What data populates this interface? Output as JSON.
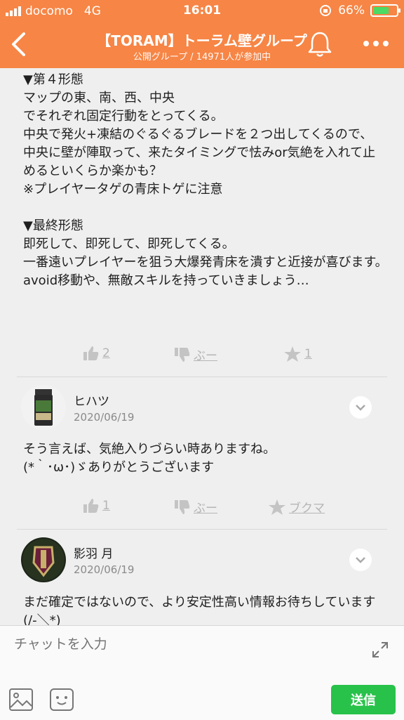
{
  "status_bar": {
    "carrier": "docomo",
    "network": "4G",
    "time": "16:01",
    "battery": "66%"
  },
  "header": {
    "title": "【TORAM】トーラム壁グループ",
    "subtitle": "公開グループ / 14971人が参加中"
  },
  "post": {
    "text": "▼第４形態\nマップの東、南、西、中央\nでそれぞれ固定行動をとってくる。\n中央で発火+凍結のぐるぐるブレードを２つ出してくるので、\n中央に壁が陣取って、来たタイミングで怯みor気絶を入れて止めるといくらか楽かも？\n※プレイヤータゲの青床トゲに注意\n\n▼最終形態\n即死して、即死して、即死してくる。\n一番遠いプレイヤーを狙う大爆発青床を潰すと近接が喜びます。\navoid移動や、無敵スキルを持っていきましょう…",
    "likes": "2",
    "boo": "ぶー",
    "stars": "1"
  },
  "comments": [
    {
      "name": "ヒハツ",
      "date": "2020/06/19",
      "text": "そう言えば、気絶入りづらい時ありますね。\n(*｀･ω･)ゞありがとうございます",
      "likes": "1",
      "boo": "ぶー",
      "bookmark": "ブクマ"
    },
    {
      "name": "影羽 月",
      "date": "2020/06/19",
      "text": "まだ確定ではないので、より安定性高い情報お待ちしています(/-＼*)"
    }
  ],
  "chat": {
    "placeholder": "チャットを入力",
    "send": "送信"
  },
  "colors": {
    "header": "#f78545",
    "send": "#28c24a",
    "battery": "#4cd964"
  }
}
